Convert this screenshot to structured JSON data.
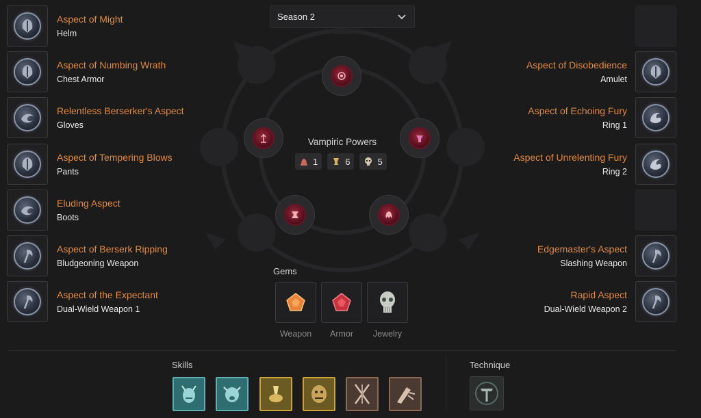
{
  "season_select": {
    "value": "Season 2"
  },
  "left_slots": [
    {
      "aspect": "Aspect of Might",
      "slot": "Helm",
      "icon": "helm-aspect-icon"
    },
    {
      "aspect": "Aspect of Numbing Wrath",
      "slot": "Chest Armor",
      "icon": "shield-aspect-icon"
    },
    {
      "aspect": "Relentless Berserker's Aspect",
      "slot": "Gloves",
      "icon": "serpent-aspect-icon"
    },
    {
      "aspect": "Aspect of Tempering Blows",
      "slot": "Pants",
      "icon": "shield-aspect-icon"
    },
    {
      "aspect": "Eluding Aspect",
      "slot": "Boots",
      "icon": "serpent-aspect-icon"
    },
    {
      "aspect": "Aspect of Berserk Ripping",
      "slot": "Bludgeoning Weapon",
      "icon": "axe-aspect-icon"
    },
    {
      "aspect": "Aspect of the Expectant",
      "slot": "Dual-Wield Weapon 1",
      "icon": "axe-aspect-icon"
    }
  ],
  "right_slots": [
    {
      "aspect": "Aspect of Disobedience",
      "slot": "Amulet",
      "icon": "shield-aspect-icon"
    },
    {
      "aspect": "Aspect of Echoing Fury",
      "slot": "Ring 1",
      "icon": "dragon-aspect-icon"
    },
    {
      "aspect": "Aspect of Unrelenting Fury",
      "slot": "Ring 2",
      "icon": "dragon-aspect-icon"
    },
    {
      "aspect": "Edgemaster's Aspect",
      "slot": "Slashing Weapon",
      "icon": "axe-aspect-icon"
    },
    {
      "aspect": "Rapid Aspect",
      "slot": "Dual-Wield Weapon 2",
      "icon": "axe-aspect-icon"
    }
  ],
  "vampiric_powers": {
    "title": "Vampiric Powers",
    "counters": [
      {
        "icon": "bloody-bell-icon",
        "count": "1"
      },
      {
        "icon": "chalice-icon",
        "count": "6"
      },
      {
        "icon": "skull-mask-icon",
        "count": "5"
      }
    ]
  },
  "gems": {
    "label": "Gems",
    "items": [
      {
        "caption": "Weapon",
        "icon": "orange-gem-icon",
        "color": "#e9843a"
      },
      {
        "caption": "Armor",
        "icon": "red-gem-icon",
        "color": "#c8323c"
      },
      {
        "caption": "Jewelry",
        "icon": "skull-gem-icon",
        "color": "#c9ccc4"
      }
    ]
  },
  "skills": {
    "label": "Skills"
  },
  "technique": {
    "label": "Technique"
  },
  "colors": {
    "aspect_orange": "#e2893a",
    "background": "#1b1b1c"
  }
}
